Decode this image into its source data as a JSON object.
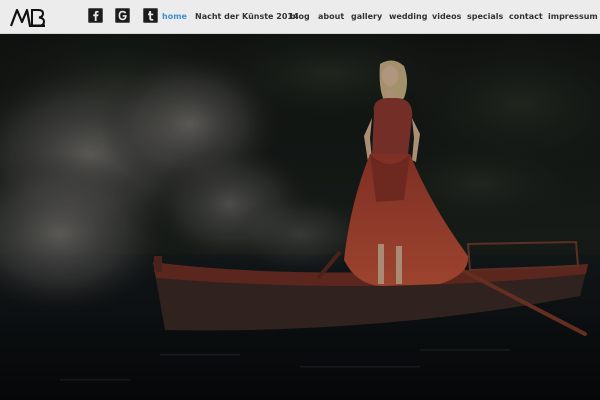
{
  "header": {
    "logo_name": "mb-logo",
    "social": [
      {
        "name": "facebook",
        "icon": "facebook-icon"
      },
      {
        "name": "google-plus",
        "icon": "google-plus-icon"
      },
      {
        "name": "tumblr",
        "icon": "tumblr-icon"
      }
    ],
    "nav": [
      {
        "label": "home",
        "active": true
      },
      {
        "label": "Nacht der Künste 2014",
        "active": false
      },
      {
        "label": "blog",
        "active": false
      },
      {
        "label": "about",
        "active": false
      },
      {
        "label": "gallery",
        "active": false
      },
      {
        "label": "wedding",
        "active": false
      },
      {
        "label": "videos",
        "active": false
      },
      {
        "label": "specials",
        "active": false
      },
      {
        "label": "contact",
        "active": false
      },
      {
        "label": "impressum",
        "active": false
      }
    ]
  },
  "colors": {
    "header_bg": "#ececec",
    "nav_text": "#333333",
    "nav_active": "#3d8fd6",
    "boat": "#8a3a2a",
    "dress": "#b0412f"
  }
}
